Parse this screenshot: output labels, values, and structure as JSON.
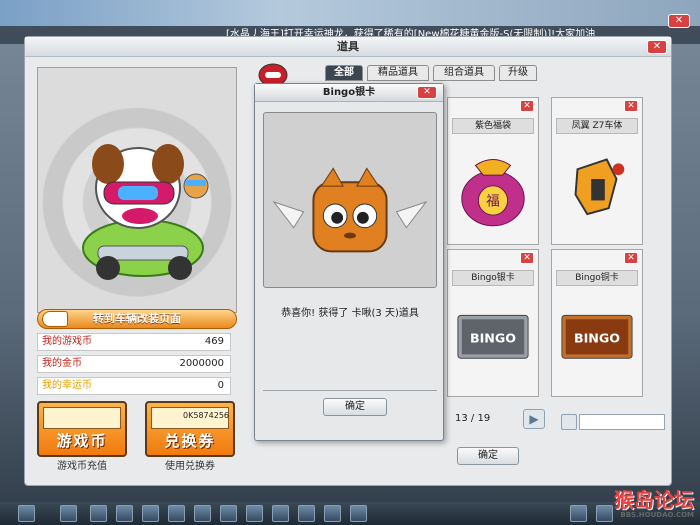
{
  "topbar": {
    "message": "[水晶丿海王]打开幸运神龙，获得了稀有的[New棉花糖黄金版-S(无限制)]!大家加油",
    "close_label": "✕"
  },
  "window": {
    "title": "道具",
    "close_label": "✕"
  },
  "character": {
    "change_button": "转到车辆改装页面"
  },
  "stats": [
    {
      "label": "我的游戏币",
      "value": "469"
    },
    {
      "label": "我的金币",
      "value": "2000000"
    },
    {
      "label": "我的幸运币",
      "value": "0"
    }
  ],
  "actions": {
    "game_coin": {
      "label": "游戏币",
      "caption": "游戏币充值"
    },
    "voucher": {
      "label": "兑换券",
      "code": "0K5874256",
      "caption": "使用兑换券"
    }
  },
  "tabs": [
    "全部",
    "精品道具",
    "组合道具",
    "升级"
  ],
  "items": [
    {
      "name": "紫色福袋",
      "badge": "福",
      "delete_label": "✕"
    },
    {
      "name": "凤翼 Z7车体",
      "delete_label": "✕"
    },
    {
      "name": "Bingo银卡",
      "card_text": "BINGO",
      "delete_label": "✕"
    },
    {
      "name": "Bingo铜卡",
      "card_text": "BINGO",
      "delete_label": "✕"
    }
  ],
  "pager": {
    "text": "13 / 19",
    "next_label": "▶"
  },
  "main_ok": "确定",
  "dialog": {
    "title": "Bingo银卡",
    "close_label": "✕",
    "message": "恭喜你! 获得了 卡啾(3 天)道具",
    "ok": "确定"
  },
  "watermark": {
    "text": "猴岛论坛",
    "sub": "BBS.HOUDAO.COM"
  },
  "colors": {
    "accent": "#f07a0e",
    "close_red": "#d94040",
    "active_tab": "#3c4650"
  }
}
